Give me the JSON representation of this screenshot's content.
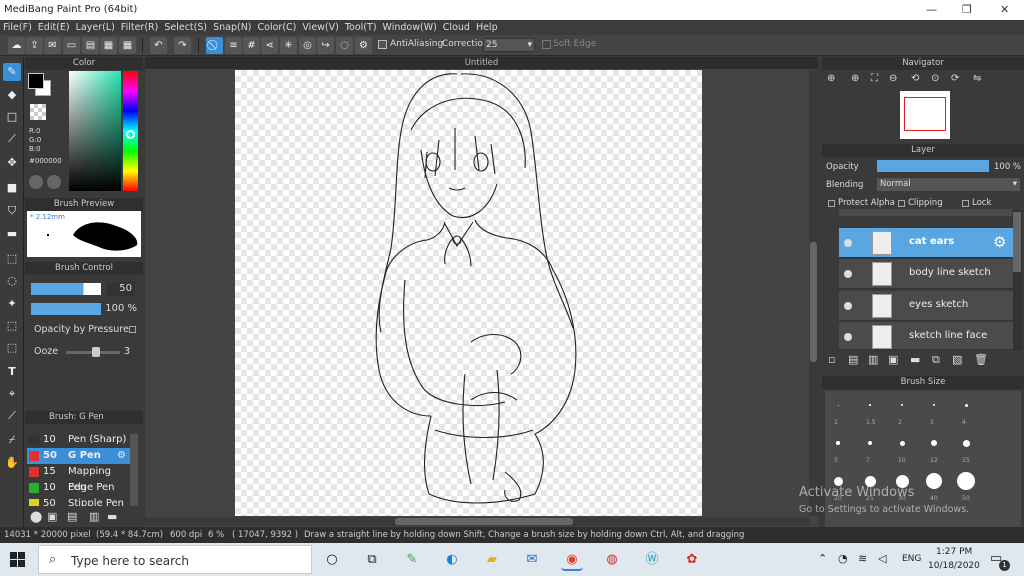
{
  "window": {
    "title": "MediBang Paint Pro (64bit)"
  },
  "menu": [
    "File(F)",
    "Edit(E)",
    "Layer(L)",
    "Filter(R)",
    "Select(S)",
    "Snap(N)",
    "Color(C)",
    "View(V)",
    "Tool(T)",
    "Window(W)",
    "Cloud",
    "Help"
  ],
  "toolbar": {
    "antialiasing_label": "AntiAliasing",
    "correction_label": "Correction",
    "correction_value": "25",
    "soft_edge_label": "Soft Edge"
  },
  "color_panel": {
    "title": "Color",
    "r": "R:0",
    "g": "G:0",
    "b": "B:0",
    "hex": "#000000",
    "fg": "#000000",
    "bg": "#ffffff"
  },
  "brush_preview": {
    "title": "Brush Preview",
    "size": "* 2.12mm"
  },
  "brush_control": {
    "title": "Brush Control",
    "size_value": "50",
    "opacity_value": "100 %",
    "opacity_by_pressure": "Opacity by Pressure",
    "ooze_label": "Ooze",
    "ooze_value": "3"
  },
  "brush_list": {
    "title": "Brush: G Pen",
    "items": [
      {
        "size": "10",
        "name": "Pen (Sharp)",
        "color": "#333333"
      },
      {
        "size": "50",
        "name": "G Pen",
        "color": "#e03030"
      },
      {
        "size": "15",
        "name": "Mapping Pen",
        "color": "#e03030"
      },
      {
        "size": "10",
        "name": "Edge Pen",
        "color": "#28b028"
      },
      {
        "size": "50",
        "name": "Stipple Pen",
        "color": "#e0d020"
      }
    ]
  },
  "canvas": {
    "title": "Untitled"
  },
  "navigator": {
    "title": "Navigator"
  },
  "layer_panel": {
    "title": "Layer",
    "opacity_label": "Opacity",
    "opacity_value": "100 %",
    "opacity_level": 1.0,
    "blending_label": "Blending",
    "blending_value": "Normal",
    "protect_alpha": "Protect Alpha",
    "clipping": "Clipping",
    "lock": "Lock",
    "layers": [
      {
        "name": "cat ears"
      },
      {
        "name": "body line sketch"
      },
      {
        "name": "eyes sketch"
      },
      {
        "name": "sketch line face"
      }
    ]
  },
  "brush_size": {
    "title": "Brush Size",
    "sizes": [
      "1",
      "1.5",
      "2",
      "3",
      "4",
      "5",
      "7",
      "10",
      "12",
      "15",
      "20",
      "25",
      "30",
      "40",
      "50"
    ]
  },
  "watermark": {
    "line1": "Activate Windows",
    "line2": "Go to Settings to activate Windows."
  },
  "status": {
    "size": "14031 * 20000 pixel",
    "mm": "(59.4 * 84.7cm)",
    "dpi": "600 dpi",
    "zoom": "6 %",
    "coords": "( 17047, 9392 )",
    "hint": "Draw a straight line by holding down Shift, Change a brush size by holding down Ctrl, Alt, and dragging"
  },
  "taskbar": {
    "search_placeholder": "Type here to search",
    "lang": "ENG",
    "time": "1:27 PM",
    "date": "10/18/2020",
    "notification_count": "1"
  }
}
